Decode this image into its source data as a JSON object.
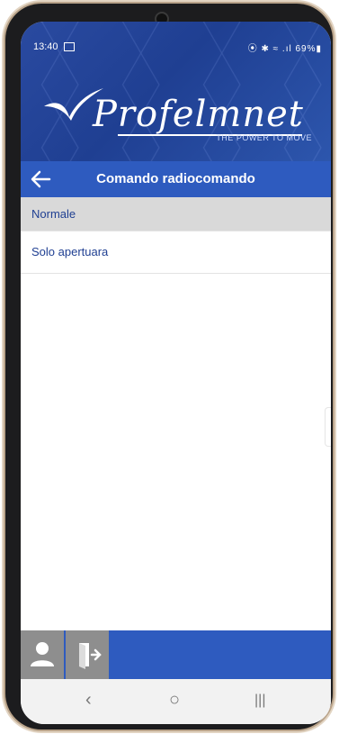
{
  "status_bar": {
    "time": "13:40",
    "right_text": "⦿ ✱ ≈ .ıl 69%▮"
  },
  "logo": {
    "brand": "Profelmnet",
    "tagline": "THE POWER TO MOVE"
  },
  "app_bar": {
    "title": "Comando radiocomando"
  },
  "list": {
    "items": [
      {
        "label": "Normale",
        "selected": true
      },
      {
        "label": "Solo apertuara",
        "selected": false
      }
    ]
  },
  "bottom_bar": {
    "user_button": "user-icon",
    "exit_button": "exit-icon"
  },
  "nav_bar": {
    "back": "‹",
    "home": "○",
    "recents": "|||"
  },
  "colors": {
    "primary": "#2e5bbf",
    "header": "#1f3f92",
    "selected_row": "#d9d9d9",
    "button_gray": "#8e8e8e"
  }
}
